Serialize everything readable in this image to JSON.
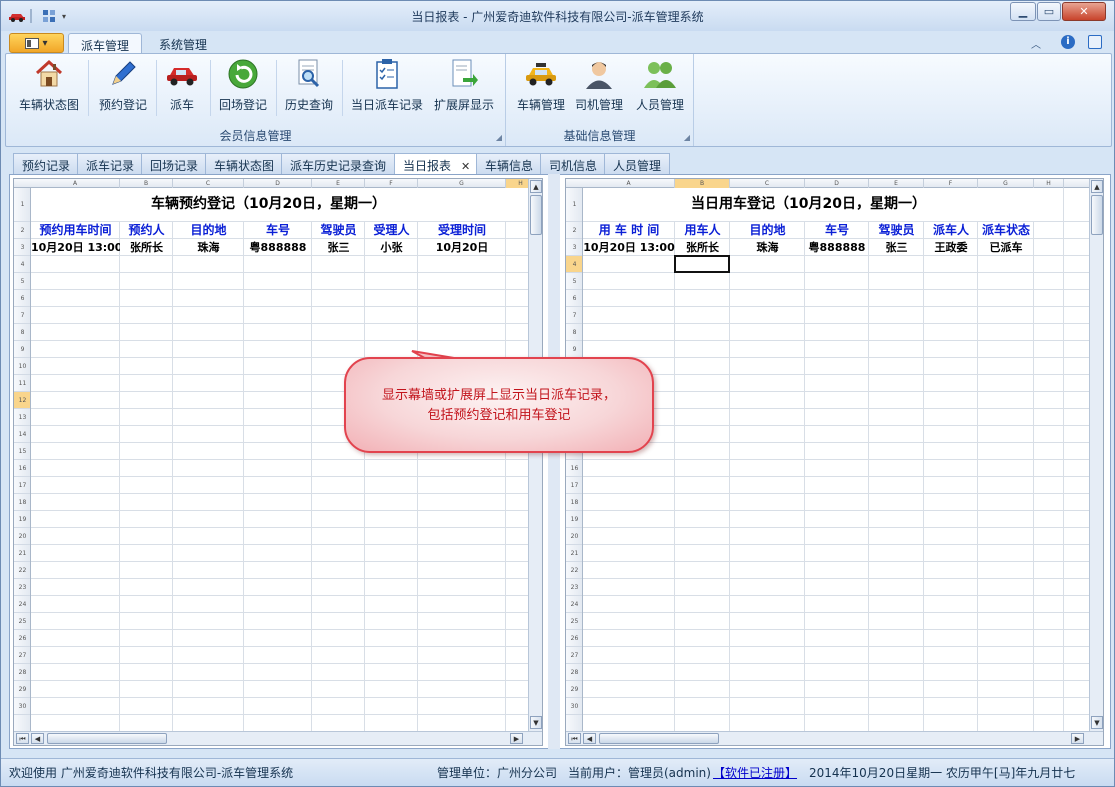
{
  "window": {
    "title": "当日报表 - 广州爱奇迪软件科技有限公司-派车管理系统"
  },
  "menu_tabs": [
    "派车管理",
    "系统管理"
  ],
  "ribbon": {
    "groups": [
      {
        "label": "会员信息管理",
        "buttons": [
          {
            "label": "车辆状态图",
            "icon": "house-icon"
          },
          {
            "label": "预约登记",
            "icon": "pencil-icon"
          },
          {
            "label": "派车",
            "icon": "red-car-icon"
          },
          {
            "label": "回场登记",
            "icon": "green-refresh-icon"
          },
          {
            "label": "历史查询",
            "icon": "document-search-icon"
          },
          {
            "label": "当日派车记录",
            "icon": "clipboard-checklist-icon"
          },
          {
            "label": "扩展屏显示",
            "icon": "export-document-icon"
          }
        ]
      },
      {
        "label": "基础信息管理",
        "buttons": [
          {
            "label": "车辆管理",
            "icon": "taxi-icon"
          },
          {
            "label": "司机管理",
            "icon": "driver-avatar-icon"
          },
          {
            "label": "人员管理",
            "icon": "people-group-icon"
          }
        ]
      }
    ]
  },
  "doc_tabs": [
    "预约记录",
    "派车记录",
    "回场记录",
    "车辆状态图",
    "派车历史记录查询",
    "当日报表",
    "车辆信息",
    "司机信息",
    "人员管理"
  ],
  "active_doc_tab": "当日报表",
  "left_sheet": {
    "title": "车辆预约登记（10月20日，星期一）",
    "columns": [
      "A",
      "B",
      "C",
      "D",
      "E",
      "F",
      "G",
      "H"
    ],
    "headers": [
      "预约用车时间",
      "预约人",
      "目的地",
      "车号",
      "驾驶员",
      "受理人",
      "受理时间"
    ],
    "rows": [
      [
        "10月20日 13:00",
        "张所长",
        "珠海",
        "粤888888",
        "张三",
        "小张",
        "10月20日"
      ]
    ],
    "row_count": 30,
    "selected_row": 12
  },
  "right_sheet": {
    "title": "当日用车登记（10月20日，星期一）",
    "columns": [
      "A",
      "B",
      "C",
      "D",
      "E",
      "F",
      "G",
      "H"
    ],
    "headers": [
      "用 车 时 间",
      "用车人",
      "目的地",
      "车号",
      "驾驶员",
      "派车人",
      "派车状态"
    ],
    "rows": [
      [
        "10月20日 13:00",
        "张所长",
        "珠海",
        "粤888888",
        "张三",
        "王政委",
        "已派车"
      ]
    ],
    "row_count": 30,
    "selected_row": 4
  },
  "callout": {
    "text": "显示幕墙或扩展屏上显示当日派车记录，\n包括预约登记和用车登记"
  },
  "statusbar": {
    "welcome": "欢迎使用 广州爱奇迪软件科技有限公司-派车管理系统",
    "unit": "管理单位：广州分公司",
    "user": "当前用户：管理员(admin)",
    "registered": "【软件已注册】",
    "date": "2014年10月20日星期一 农历甲午[马]年九月廿七"
  },
  "colors": {
    "accent": "#0a1fd6",
    "callout_text": "#c2141c",
    "callout_border": "#e2434e",
    "file_button": "#f1a628"
  }
}
